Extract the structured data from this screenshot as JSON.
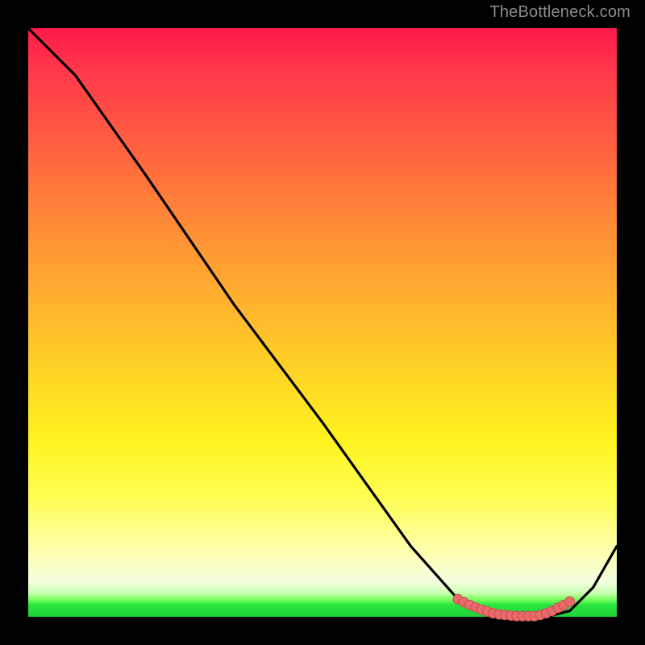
{
  "attribution": "TheBottleneck.com",
  "chart_data": {
    "type": "line",
    "title": "",
    "xlabel": "",
    "ylabel": "",
    "xlim": [
      0,
      100
    ],
    "ylim": [
      0,
      100
    ],
    "grid": false,
    "legend": false,
    "series": [
      {
        "name": "curve",
        "x": [
          0,
          8,
          20,
          35,
          50,
          65,
          73,
          78,
          82,
          85,
          88,
          92,
          96,
          100
        ],
        "values": [
          100,
          92,
          75,
          53,
          33,
          12,
          3,
          1,
          0,
          0,
          0,
          1,
          5,
          12
        ]
      }
    ],
    "highlight_cluster": {
      "name": "bottom-dots",
      "points": [
        {
          "x": 73,
          "y": 3.0
        },
        {
          "x": 74,
          "y": 2.5
        },
        {
          "x": 75,
          "y": 2.0
        },
        {
          "x": 76,
          "y": 1.6
        },
        {
          "x": 77,
          "y": 1.2
        },
        {
          "x": 78,
          "y": 0.9
        },
        {
          "x": 79,
          "y": 0.6
        },
        {
          "x": 80,
          "y": 0.4
        },
        {
          "x": 81,
          "y": 0.3
        },
        {
          "x": 82,
          "y": 0.2
        },
        {
          "x": 83,
          "y": 0.1
        },
        {
          "x": 84,
          "y": 0.1
        },
        {
          "x": 85,
          "y": 0.1
        },
        {
          "x": 86,
          "y": 0.1
        },
        {
          "x": 87,
          "y": 0.3
        },
        {
          "x": 88,
          "y": 0.6
        },
        {
          "x": 89,
          "y": 1.0
        },
        {
          "x": 90,
          "y": 1.5
        },
        {
          "x": 91,
          "y": 2.0
        },
        {
          "x": 92,
          "y": 2.6
        }
      ]
    },
    "colors": {
      "line": "#000000",
      "dot_fill": "#e86a6a",
      "dot_stroke": "#c94f4f"
    }
  }
}
